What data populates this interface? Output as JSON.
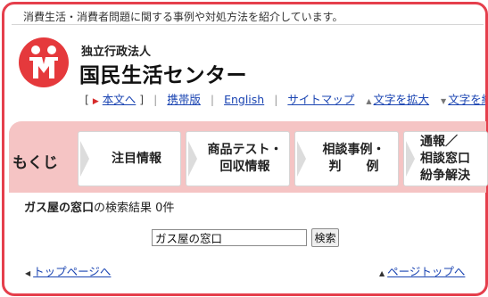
{
  "header": {
    "tagline": "消費生活・消費者問題に関する事例や対処方法を紹介しています。",
    "org_sub": "独立行政法人",
    "org_main": "国民生活センター",
    "logo_icon": "person-logo-icon"
  },
  "utility": {
    "skip_bracket_open": "[",
    "skip_label": "本文へ",
    "skip_bracket_close": "]",
    "mobile": "携帯版",
    "english": "English",
    "sitemap": "サイトマップ",
    "text_larger": "文字を拡大",
    "text_smaller": "文字を縮小"
  },
  "nav": {
    "mokuji": "もくじ",
    "tabs": [
      {
        "label": "注目情報"
      },
      {
        "label": "商品テスト・\n回収情報"
      },
      {
        "label": "相談事例・\n判　　例"
      },
      {
        "label": "通報／\n相談窓口\n紛争解決"
      }
    ]
  },
  "result": {
    "query": "ガス屋の窓口",
    "suffix": "の検索結果",
    "count": "0件"
  },
  "search": {
    "value": "ガス屋の窓口",
    "button": "検索"
  },
  "footer": {
    "top_page": "トップページへ",
    "page_top": "ページトップへ"
  },
  "colors": {
    "brand_red": "#e5393c",
    "tab_band": "#f5c4c4",
    "link": "#1a44b2"
  }
}
